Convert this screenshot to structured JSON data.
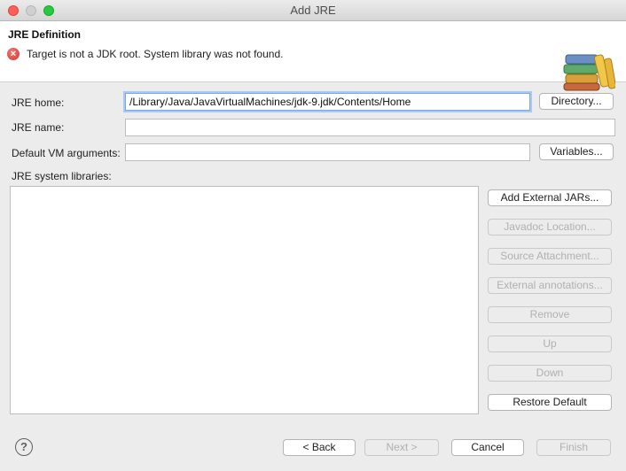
{
  "window": {
    "title": "Add JRE"
  },
  "header": {
    "title": "JRE Definition",
    "message": "Target is not a JDK root. System library was not found.",
    "error_icon": "error-icon",
    "banner_icon": "books-icon"
  },
  "form": {
    "jre_home_label": "JRE home:",
    "jre_home_value": "/Library/Java/JavaVirtualMachines/jdk-9.jdk/Contents/Home",
    "directory_button": "Directory...",
    "jre_name_label": "JRE name:",
    "jre_name_value": "",
    "vm_args_label": "Default VM arguments:",
    "vm_args_value": "",
    "variables_button": "Variables...",
    "libraries_label": "JRE system libraries:"
  },
  "library_buttons": {
    "add_external_jars": "Add External JARs...",
    "javadoc_location": "Javadoc Location...",
    "source_attachment": "Source Attachment...",
    "external_annotations": "External annotations...",
    "remove": "Remove",
    "up": "Up",
    "down": "Down",
    "restore_default": "Restore Default"
  },
  "footer": {
    "help_icon_glyph": "?",
    "back": "< Back",
    "next": "Next >",
    "cancel": "Cancel",
    "finish": "Finish"
  },
  "colors": {
    "error": "#d9342b",
    "focus_ring": "#a9c8f3",
    "close": "#ff5f57",
    "maximize": "#28c840"
  }
}
